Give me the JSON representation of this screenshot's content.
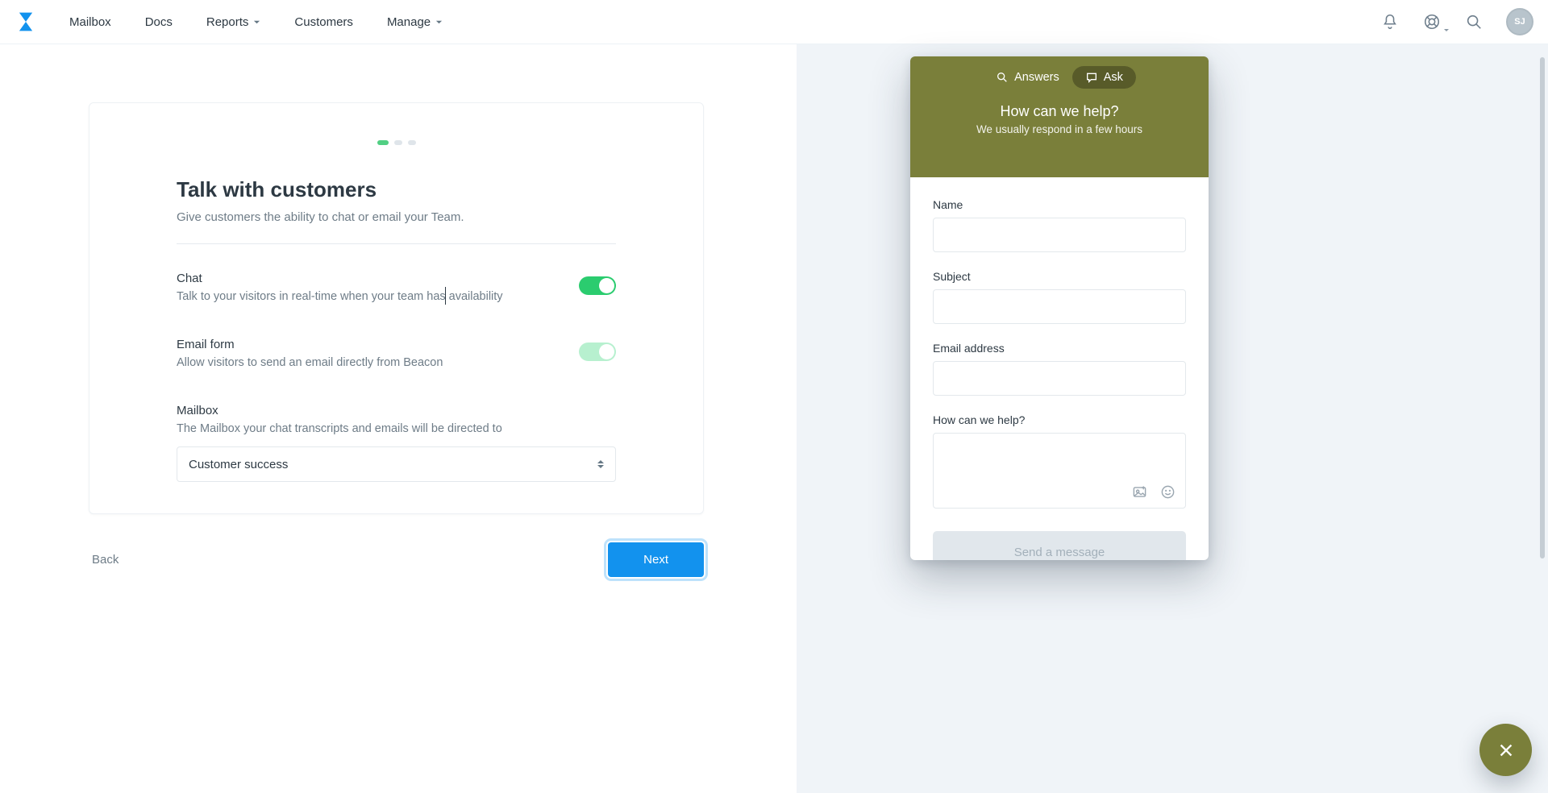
{
  "nav": {
    "items": [
      {
        "label": "Mailbox",
        "caret": false
      },
      {
        "label": "Docs",
        "caret": false
      },
      {
        "label": "Reports",
        "caret": true
      },
      {
        "label": "Customers",
        "caret": false
      },
      {
        "label": "Manage",
        "caret": true
      }
    ],
    "avatar_initials": "SJ"
  },
  "card": {
    "title": "Talk with customers",
    "subtitle": "Give customers the ability to chat or email your Team.",
    "chat": {
      "title": "Chat",
      "desc": "Talk to your visitors in real-time when your team has availability",
      "enabled": true
    },
    "email": {
      "title": "Email form",
      "desc": "Allow visitors to send an email directly from Beacon",
      "enabled": true
    },
    "mailbox": {
      "title": "Mailbox",
      "desc": "The Mailbox your chat transcripts and emails will be directed to",
      "selected": "Customer success"
    }
  },
  "controls": {
    "back": "Back",
    "next": "Next"
  },
  "beacon": {
    "tab_answers": "Answers",
    "tab_ask": "Ask",
    "title": "How can we help?",
    "subtitle": "We usually respond in a few hours",
    "fields": {
      "name": "Name",
      "subject": "Subject",
      "email": "Email address",
      "message": "How can we help?"
    },
    "send": "Send a message"
  }
}
